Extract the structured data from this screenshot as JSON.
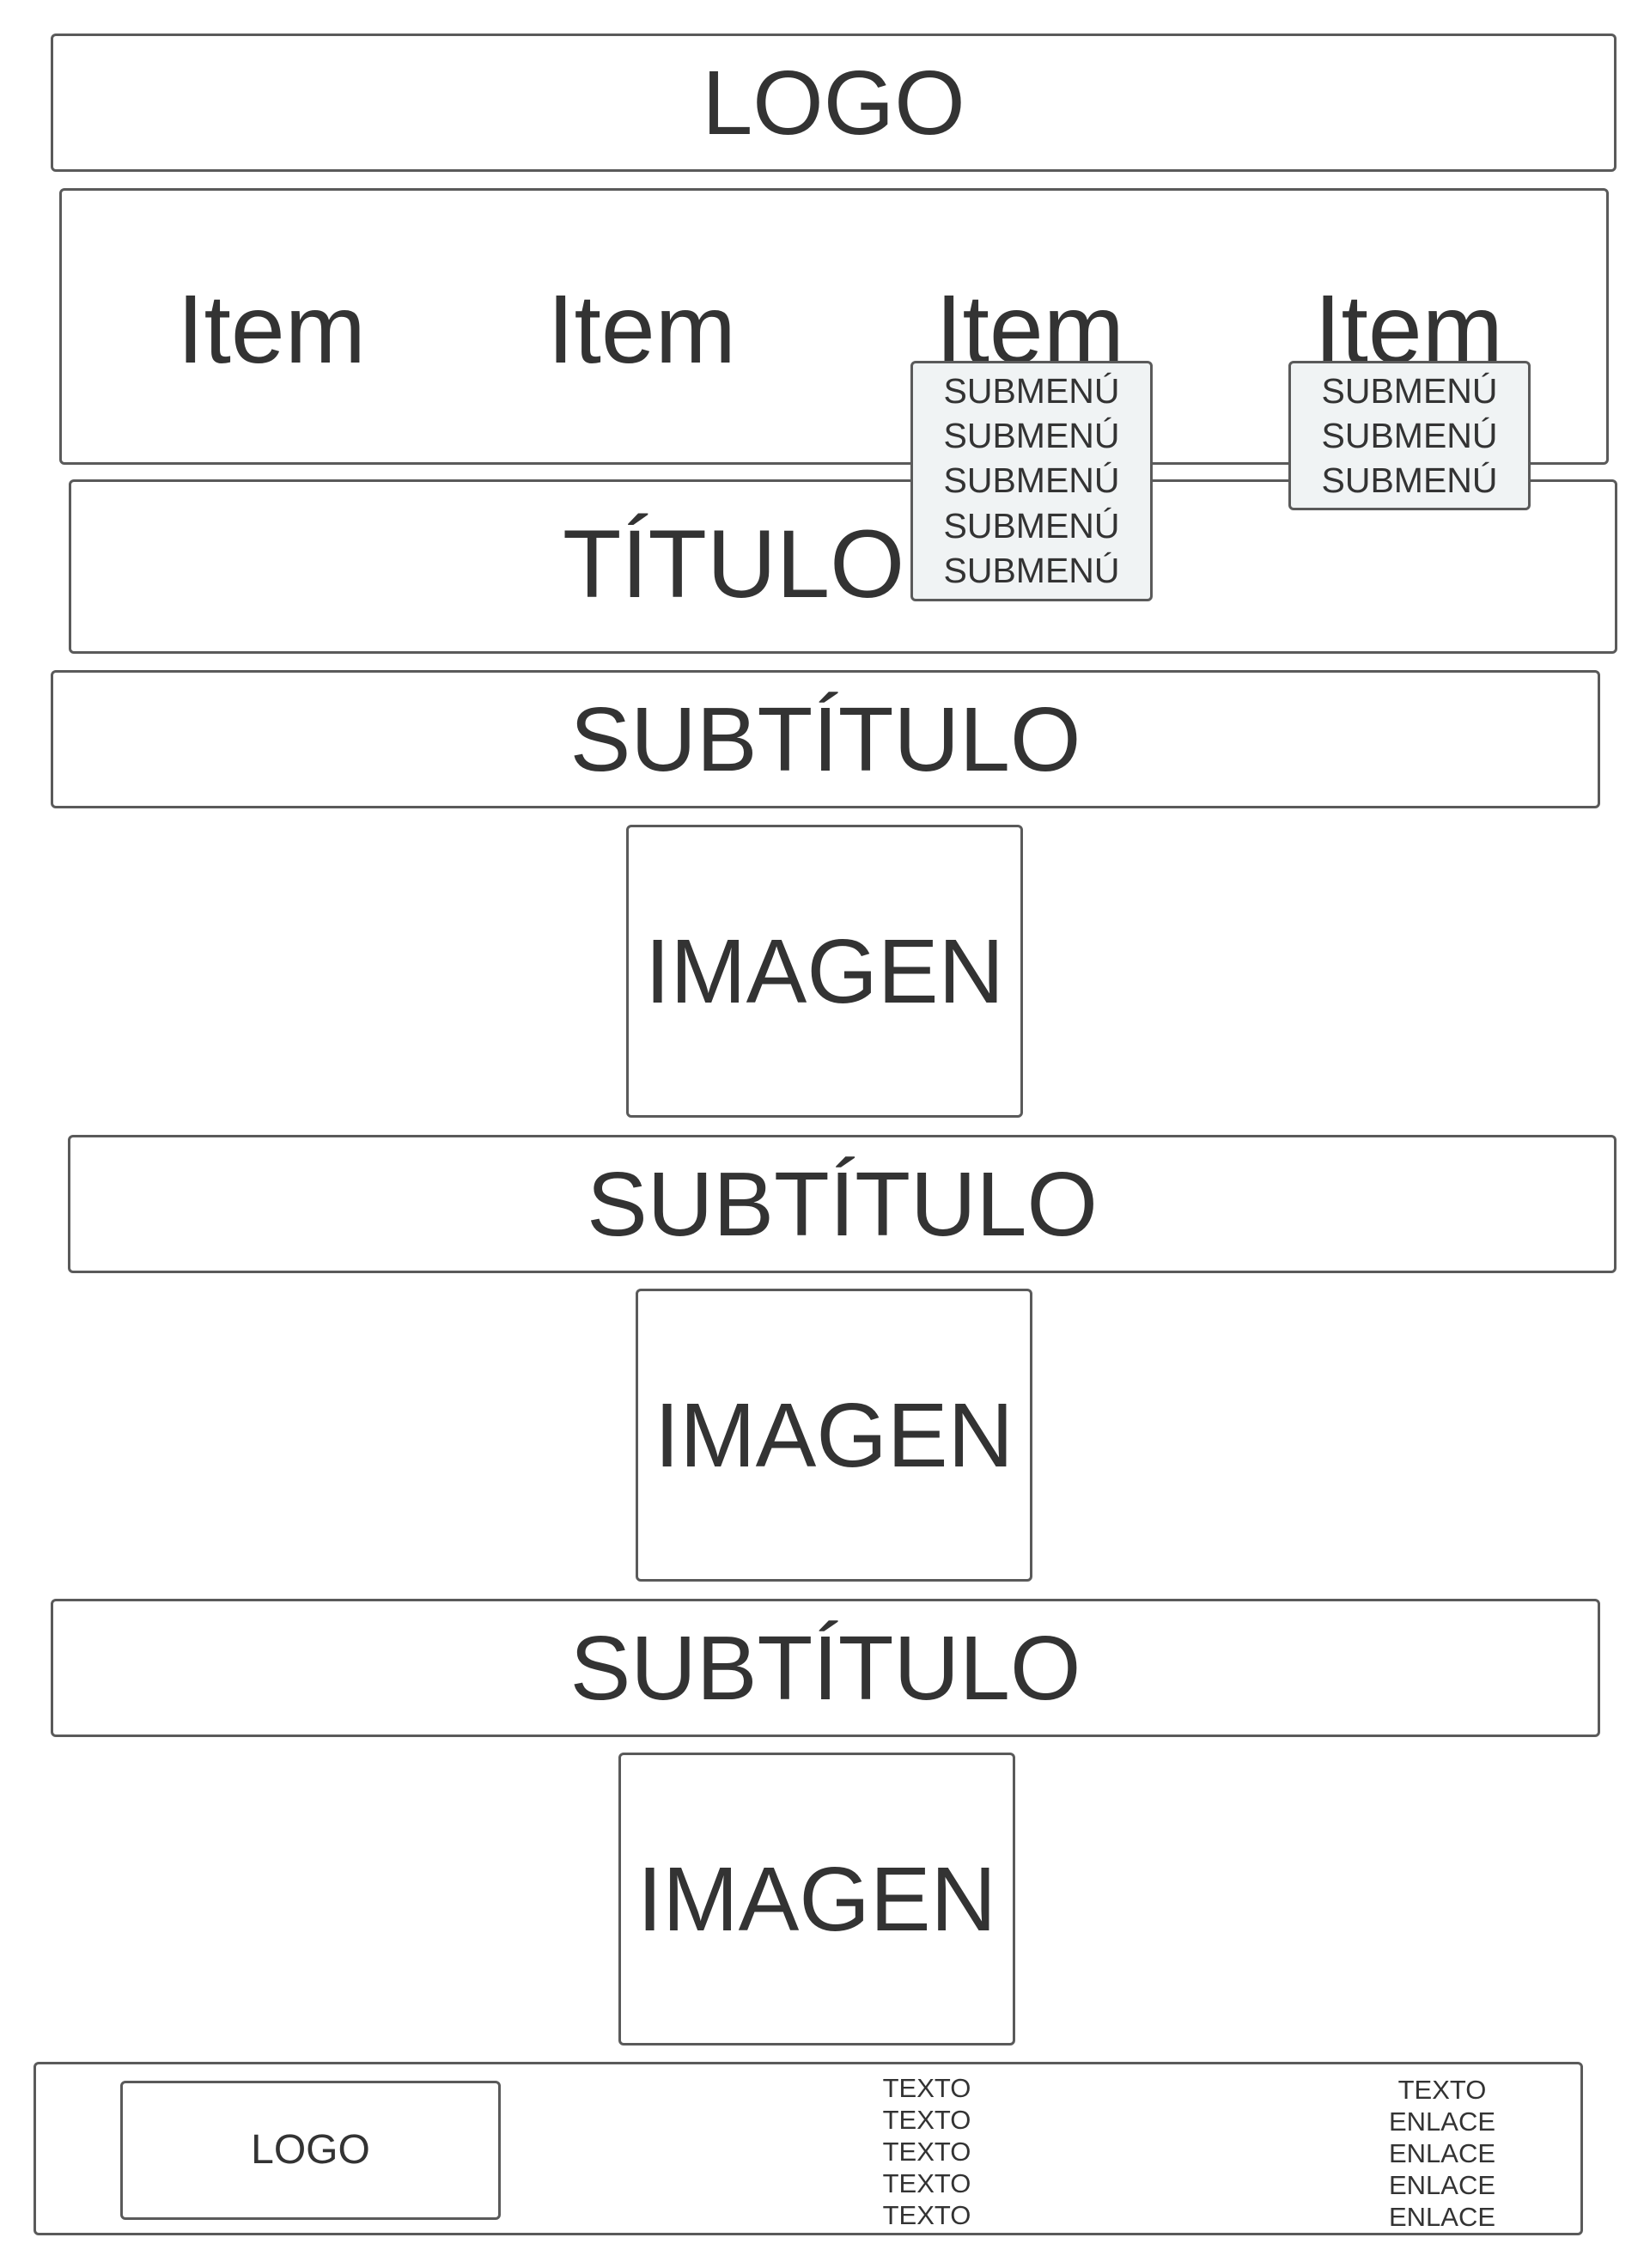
{
  "header": {
    "logo": "LOGO"
  },
  "nav": {
    "items": [
      {
        "label": "Item"
      },
      {
        "label": "Item"
      },
      {
        "label": "Item",
        "submenu": [
          "SUBMENÚ",
          "SUBMENÚ",
          "SUBMENÚ",
          "SUBMENÚ",
          "SUBMENÚ"
        ]
      },
      {
        "label": "Item",
        "submenu": [
          "SUBMENÚ",
          "SUBMENÚ",
          "SUBMENÚ"
        ]
      }
    ]
  },
  "title": "TÍTULO",
  "sections": [
    {
      "subtitle": "SUBTÍTULO",
      "image": "IMAGEN"
    },
    {
      "subtitle": "SUBTÍTULO",
      "image": "IMAGEN"
    },
    {
      "subtitle": "SUBTÍTULO",
      "image": "IMAGEN"
    }
  ],
  "footer": {
    "logo": "LOGO",
    "column_1": [
      "TEXTO",
      "TEXTO",
      "TEXTO",
      "TEXTO",
      "TEXTO"
    ],
    "column_2": [
      "TEXTO",
      "ENLACE",
      "ENLACE",
      "ENLACE",
      "ENLACE"
    ]
  }
}
